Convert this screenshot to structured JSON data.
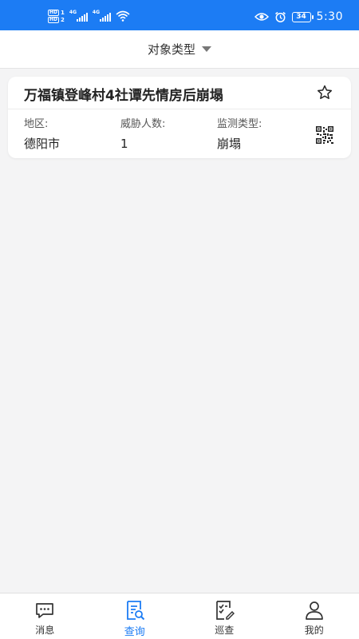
{
  "status_bar": {
    "hd1": "HD",
    "hd1_num": "1",
    "hd2": "HD",
    "hd2_num": "2",
    "net1": "4G",
    "net2": "4G",
    "battery": "34",
    "time": "5:30"
  },
  "filter": {
    "label": "对象类型"
  },
  "card": {
    "title": "万福镇登峰村4社谭先情房后崩塌",
    "region_label": "地区:",
    "region_value": "德阳市",
    "threat_label": "威胁人数:",
    "threat_value": "1",
    "monitor_label": "监测类型:",
    "monitor_value": "崩塌"
  },
  "nav": {
    "items": [
      {
        "label": "消息",
        "icon": "message-icon"
      },
      {
        "label": "查询",
        "icon": "query-icon"
      },
      {
        "label": "巡查",
        "icon": "inspection-icon"
      },
      {
        "label": "我的",
        "icon": "profile-icon"
      }
    ],
    "active_index": 1
  },
  "colors": {
    "accent": "#1c7cf4",
    "background": "#f4f4f5"
  }
}
